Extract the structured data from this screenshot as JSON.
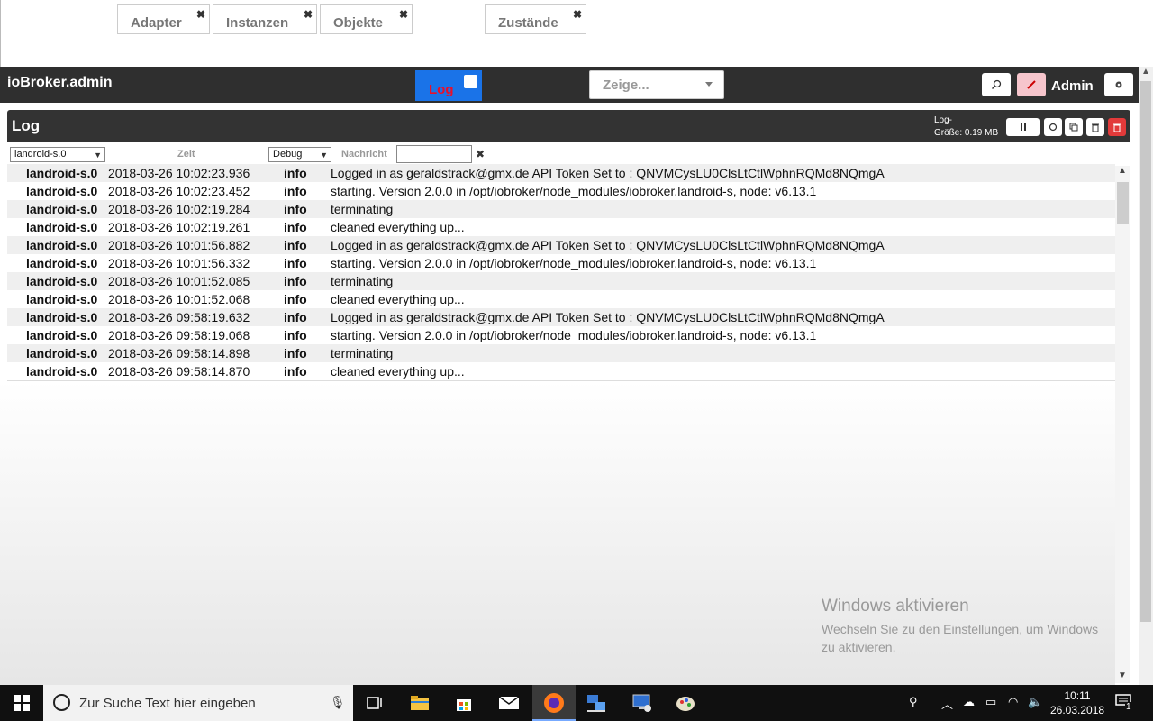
{
  "app": {
    "brand": "ioBroker.admin",
    "tabs": [
      {
        "label": "Adapter"
      },
      {
        "label": "Instanzen"
      },
      {
        "label": "Objekte"
      },
      {
        "label": "Log"
      },
      {
        "label": "Zustände"
      }
    ],
    "tab_close": "✖",
    "show_select": "Zeige...",
    "user": "Admin"
  },
  "log": {
    "title": "Log",
    "size_label": "Log-",
    "size_value": "Größe: 0.19 MB",
    "filters": {
      "source": "landroid-s.0",
      "time_header": "Zeit",
      "severity": "Debug",
      "message_header": "Nachricht",
      "clear": "✖"
    },
    "rows": [
      {
        "src": "landroid-s.0",
        "time": "2018-03-26 10:02:23.936",
        "sev": "info",
        "msg": "Logged in as geraldstrack@gmx.de API Token Set to : QNVMCysLU0ClsLtCtlWphnRQMd8NQmgA"
      },
      {
        "src": "landroid-s.0",
        "time": "2018-03-26 10:02:23.452",
        "sev": "info",
        "msg": "starting. Version 2.0.0 in /opt/iobroker/node_modules/iobroker.landroid-s, node: v6.13.1"
      },
      {
        "src": "landroid-s.0",
        "time": "2018-03-26 10:02:19.284",
        "sev": "info",
        "msg": "terminating"
      },
      {
        "src": "landroid-s.0",
        "time": "2018-03-26 10:02:19.261",
        "sev": "info",
        "msg": "cleaned everything up..."
      },
      {
        "src": "landroid-s.0",
        "time": "2018-03-26 10:01:56.882",
        "sev": "info",
        "msg": "Logged in as geraldstrack@gmx.de API Token Set to : QNVMCysLU0ClsLtCtlWphnRQMd8NQmgA"
      },
      {
        "src": "landroid-s.0",
        "time": "2018-03-26 10:01:56.332",
        "sev": "info",
        "msg": "starting. Version 2.0.0 in /opt/iobroker/node_modules/iobroker.landroid-s, node: v6.13.1"
      },
      {
        "src": "landroid-s.0",
        "time": "2018-03-26 10:01:52.085",
        "sev": "info",
        "msg": "terminating"
      },
      {
        "src": "landroid-s.0",
        "time": "2018-03-26 10:01:52.068",
        "sev": "info",
        "msg": "cleaned everything up..."
      },
      {
        "src": "landroid-s.0",
        "time": "2018-03-26 09:58:19.632",
        "sev": "info",
        "msg": "Logged in as geraldstrack@gmx.de API Token Set to : QNVMCysLU0ClsLtCtlWphnRQMd8NQmgA"
      },
      {
        "src": "landroid-s.0",
        "time": "2018-03-26 09:58:19.068",
        "sev": "info",
        "msg": "starting. Version 2.0.0 in /opt/iobroker/node_modules/iobroker.landroid-s, node: v6.13.1"
      },
      {
        "src": "landroid-s.0",
        "time": "2018-03-26 09:58:14.898",
        "sev": "info",
        "msg": "terminating"
      },
      {
        "src": "landroid-s.0",
        "time": "2018-03-26 09:58:14.870",
        "sev": "info",
        "msg": "cleaned everything up..."
      }
    ]
  },
  "watermark": {
    "title": "Windows aktivieren",
    "line1": "Wechseln Sie zu den Einstellungen, um Windows",
    "line2": "zu aktivieren."
  },
  "taskbar": {
    "search_placeholder": "Zur Suche Text hier eingeben",
    "time": "10:11",
    "date": "26.03.2018",
    "notification_count": "1"
  },
  "colors": {
    "header_bg": "#2f2f2f",
    "active_tab": "#1a73e8",
    "delete_red": "#e23a3a"
  }
}
